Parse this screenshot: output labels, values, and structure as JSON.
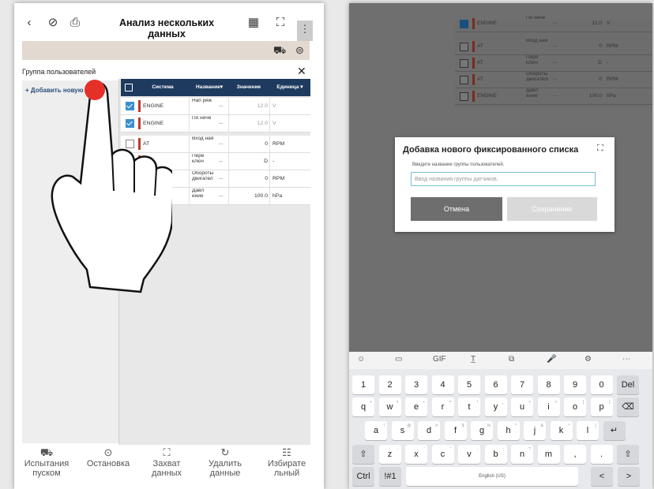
{
  "left": {
    "app_title": "Анализ нескольких данных",
    "panel_title": "Группа пользователей",
    "add_group": "+ Добавить новую группу",
    "table": {
      "headers": [
        "Система",
        "Название▾",
        "Значение",
        "Единица ▾"
      ],
      "rows": [
        {
          "checked": true,
          "system": "ENGINE",
          "name": "Нап ряж",
          "dots": "...",
          "value": "12.0",
          "unit": "V",
          "grey": true
        },
        {
          "checked": true,
          "system": "ENGINE",
          "name": "По ниче",
          "dots": "...",
          "value": "12.0",
          "unit": "V",
          "grey": true
        },
        {
          "checked": false,
          "system": "AT",
          "name": "Вход ная",
          "dots": "...",
          "value": "0",
          "unit": "RPM",
          "grey": false
        },
        {
          "checked": false,
          "system": "AT",
          "name": "Пере ключ",
          "dots": "...",
          "value": "D",
          "unit": "-",
          "grey": false
        },
        {
          "checked": false,
          "system": "AT",
          "name": "Обороты двигател",
          "dots": "...",
          "value": "0",
          "unit": "RPM",
          "grey": false
        },
        {
          "checked": false,
          "system": "ENGINE",
          "name": "Давл ение",
          "dots": "...",
          "value": "100.0",
          "unit": "hPa",
          "grey": false
        }
      ]
    },
    "nav": [
      {
        "icon": "car-test-icon",
        "glyph": "⛟",
        "label": "Испытания пуском"
      },
      {
        "icon": "stop-icon",
        "glyph": "⊙",
        "label": "Остановка"
      },
      {
        "icon": "capture-icon",
        "glyph": "⛶",
        "label": "Захват данных"
      },
      {
        "icon": "refresh-icon",
        "glyph": "↻",
        "label": "Удалить данные"
      },
      {
        "icon": "selective-icon",
        "glyph": "☷",
        "label": "Избирате льный"
      }
    ]
  },
  "right": {
    "bg_rows": [
      {
        "checked": true,
        "system": "ENGINE",
        "name": "По ниче",
        "value": "12.0",
        "unit": "V"
      },
      {
        "checked": false,
        "system": "AT",
        "name": "Вход ная",
        "value": "0",
        "unit": "RPM"
      },
      {
        "checked": false,
        "system": "AT",
        "name": "Пере ключ",
        "value": "D",
        "unit": "-"
      },
      {
        "checked": false,
        "system": "AT",
        "name": "Обороты двигателя",
        "value": "0",
        "unit": "RPM"
      },
      {
        "checked": false,
        "system": "ENGINE",
        "name": "Давл ение",
        "value": "100.0",
        "unit": "hPa"
      }
    ],
    "dialog": {
      "title": "Добавка нового фиксированного списка",
      "label": "Введите название группы пользователей.",
      "placeholder": "Ввод названия группы датчиков.",
      "cancel": "Отмена",
      "save": "Сохранение"
    },
    "keyboard": {
      "toolbar": [
        "☺",
        "▭",
        "GIF",
        "T̲",
        "⧉",
        "🎤",
        "⚙",
        "⋯"
      ],
      "row1": [
        "1",
        "2",
        "3",
        "4",
        "5",
        "6",
        "7",
        "8",
        "9",
        "0",
        "Del"
      ],
      "row2": [
        "q",
        "w",
        "e",
        "r",
        "t",
        "y",
        "u",
        "i",
        "o",
        "p",
        "⌫"
      ],
      "row2_sup": [
        "+",
        "×",
        "÷",
        "=",
        "/",
        "_",
        "<",
        ">",
        "[",
        "]",
        ""
      ],
      "row3": [
        "a",
        "s",
        "d",
        "f",
        "g",
        "h",
        "j",
        "k",
        "l",
        "↵"
      ],
      "row3_sup": [
        "!",
        "@",
        "#",
        "$",
        "%",
        "^",
        "&",
        "*",
        "(",
        ""
      ],
      "row4": [
        "⇧",
        "z",
        "x",
        "c",
        "v",
        "b",
        "n",
        "m",
        ",",
        ".",
        "⇧"
      ],
      "row4_sup": [
        "",
        "-",
        "'",
        "\"",
        ":",
        ";",
        "?",
        "",
        "",
        "",
        ""
      ],
      "row5": [
        "Ctrl",
        "!#1",
        "English (US)",
        "<",
        ">"
      ]
    }
  }
}
